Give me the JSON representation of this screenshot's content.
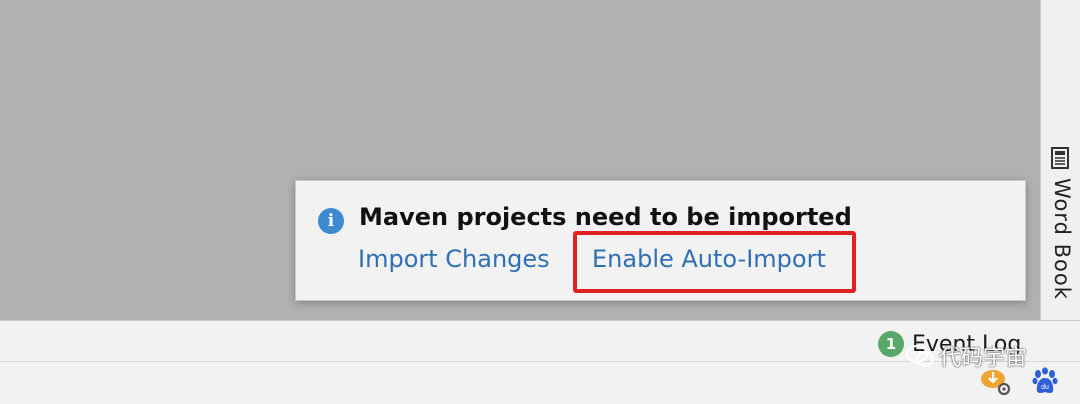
{
  "notification": {
    "title": "Maven projects need to be imported",
    "info_icon": "info-icon",
    "actions": [
      {
        "label": "Import Changes"
      },
      {
        "label": "Enable Auto-Import",
        "highlighted": true
      }
    ]
  },
  "right_toolbar": {
    "word_book_label": "Word Book",
    "word_book_icon": "book-icon"
  },
  "status_bar": {
    "event_log_badge": "1",
    "event_log_label": "Event Log"
  },
  "watermark": {
    "text": "代码宇宙",
    "icon": "wechat-icon"
  },
  "colors": {
    "editor_background": "#b1b1b1",
    "link": "#2f6fb5",
    "info_icon": "#3d8ad1",
    "highlight_box": "#e12222",
    "event_log_badge": "#59a869"
  }
}
